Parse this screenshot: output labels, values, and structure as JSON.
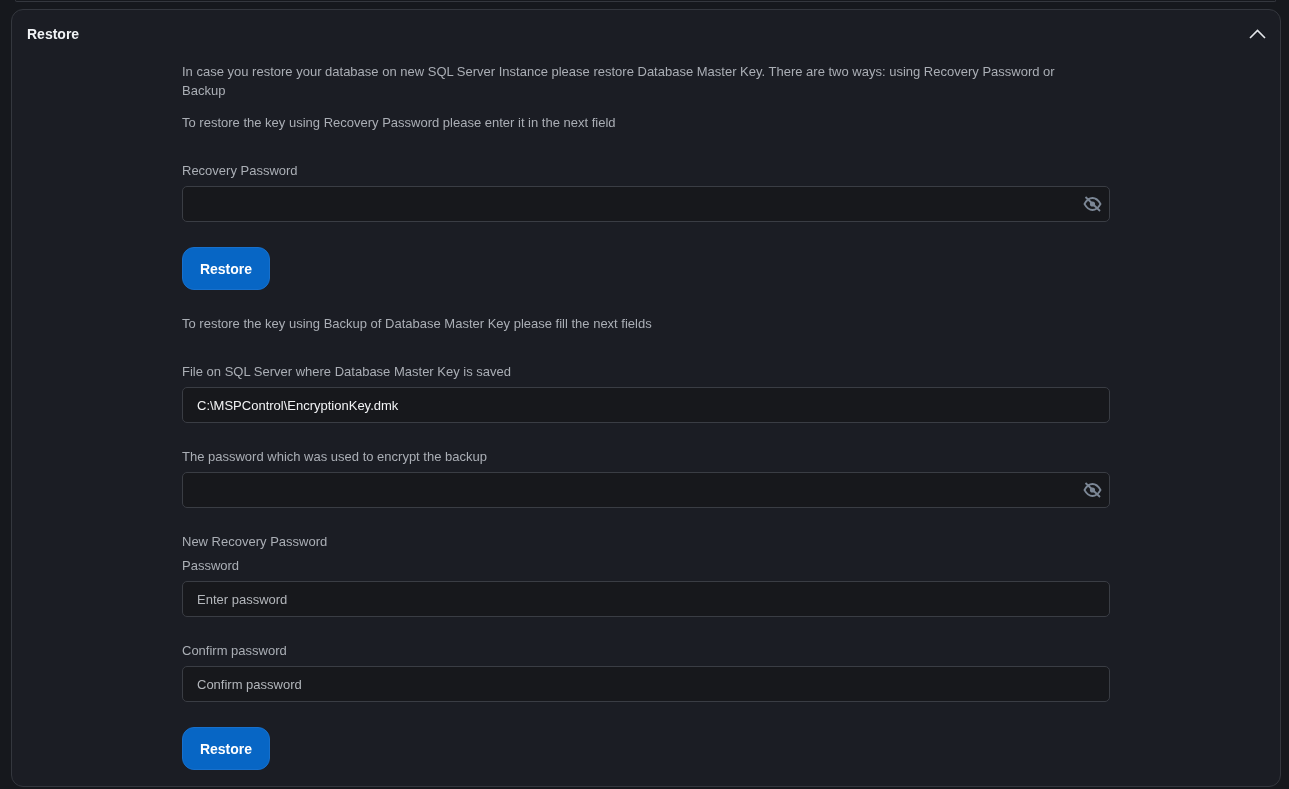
{
  "panel": {
    "title": "Restore",
    "expanded": true
  },
  "blocks": [
    {
      "kind": "text",
      "text": "In case you restore your database on new SQL Server Instance please restore Database Master Key. There are two ways: using Recovery Password or Backup"
    },
    {
      "kind": "text",
      "text": "To restore the key using Recovery Password please enter it in the next field"
    },
    {
      "kind": "password_field",
      "label": "Recovery Password",
      "revealed": false
    },
    {
      "kind": "button",
      "label": "Restore"
    },
    {
      "kind": "text",
      "text": "To restore the key using Backup of Database Master Key please fill the next fields"
    },
    {
      "kind": "text_field",
      "label": "File on SQL Server where Database Master Key is saved",
      "value": "C:\\MSPControl\\EncryptionKey.dmk"
    },
    {
      "kind": "password_field",
      "label": "The password which was used to encrypt the backup",
      "revealed": false
    },
    {
      "kind": "heading",
      "text": "New Recovery Password"
    },
    {
      "kind": "text_field",
      "label": "Password",
      "placeholder": "Enter password"
    },
    {
      "kind": "text_field",
      "label": "Confirm password",
      "placeholder": "Confirm password"
    },
    {
      "kind": "button",
      "label": "Restore"
    }
  ]
}
